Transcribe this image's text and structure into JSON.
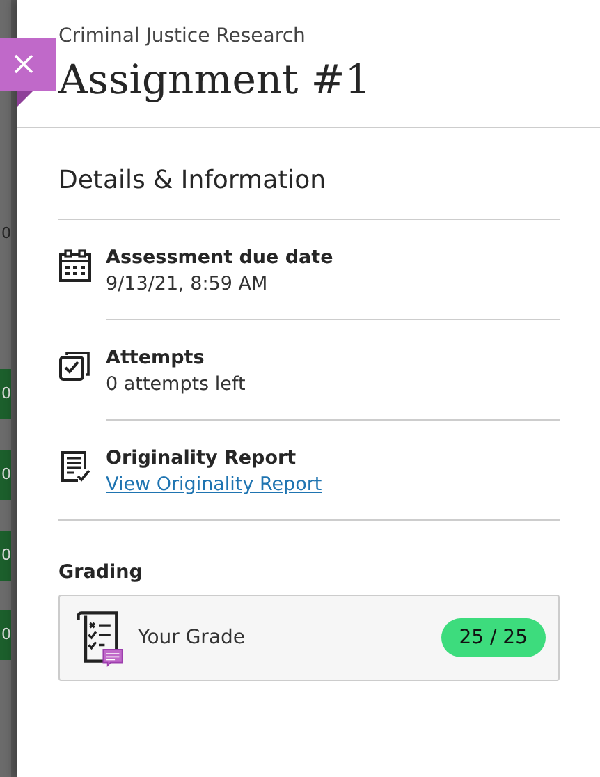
{
  "backdrop": {
    "cells": [
      {
        "text": "0",
        "kind": "plain"
      },
      {
        "text": "0",
        "kind": "graded"
      },
      {
        "text": "0",
        "kind": "graded"
      },
      {
        "text": "0",
        "kind": "graded"
      },
      {
        "text": "0",
        "kind": "graded"
      }
    ]
  },
  "panel": {
    "course": "Criminal Justice Research",
    "title": "Assignment #1"
  },
  "details": {
    "heading": "Details & Information",
    "items": [
      {
        "kind": "calendar",
        "label": "Assessment due date",
        "value": "9/13/21, 8:59 AM"
      },
      {
        "kind": "attempts",
        "label": "Attempts",
        "value": "0 attempts left"
      },
      {
        "kind": "report",
        "label": "Originality Report",
        "link": "View Originality Report"
      }
    ]
  },
  "grading": {
    "heading": "Grading",
    "label": "Your Grade",
    "grade": "25 / 25"
  }
}
